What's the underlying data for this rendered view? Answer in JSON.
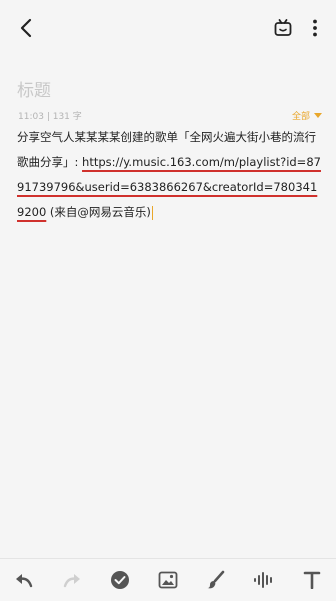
{
  "editor": {
    "title_placeholder": "标题",
    "time": "11:03",
    "separator": "|",
    "word_count": "131 字",
    "filter_label": "全部",
    "text_prefix": "分享空气人某某某某创建的歌单「全网火遍大街小巷的流行歌曲分享」: ",
    "url_text": "https://y.music.163.com/m/playlist?id=8791739796&userid=6383866267&creatorId=7803419200",
    "text_suffix": " (来自@网易云音乐)"
  },
  "icons": {
    "back": "back-arrow-icon",
    "share": "share-icon",
    "more": "more-icon",
    "undo": "undo-icon",
    "redo": "redo-icon",
    "check": "check-icon",
    "image": "image-icon",
    "brush": "brush-icon",
    "audio": "audio-icon",
    "text": "text-format-icon"
  },
  "colors": {
    "accent": "#e9a72b",
    "underline": "#d0312d"
  }
}
